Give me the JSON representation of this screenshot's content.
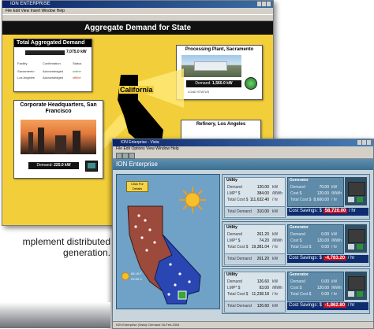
{
  "back_window": {
    "title": "ION ENTERPRISE",
    "menu": "File  Edit  View  Insert  Window  Help",
    "banner": "Aggregate Demand for State",
    "total_aggregated": {
      "title": "Total Aggregated Demand",
      "value": "7,075.0 kW",
      "columns": [
        "Facility",
        "Confirmation",
        "Status"
      ],
      "rows": [
        {
          "facility": "Sacramento",
          "confirmation": "Acknowledged",
          "status": "online"
        },
        {
          "facility": "Los Angeles",
          "confirmation": "Acknowledged",
          "status": "offline"
        }
      ]
    },
    "processing_plant": {
      "title": "Processing Plant, Sacramento",
      "demand_label": "Demand:",
      "demand_value": "1,560.0 kW",
      "status_label": "LOAD STATUS"
    },
    "state_label": "California",
    "hq": {
      "title": "Corporate Headquarters, San Francisco",
      "demand_label": "Demand:",
      "demand_value": "225.0 kW"
    },
    "refinery": {
      "title": "Refinery, Los Angeles"
    }
  },
  "front_window": {
    "title": "ION Enterprise - Vista",
    "menu": "File  Edit  Options  View  Window  Help",
    "header": "ION Enterprise",
    "map_button": "Click For Details",
    "temp_main": "85.15 F",
    "temp_sub": "29.59 C",
    "statusbar": "ION Enterprise (Vista): Demand 16-Feb-2004",
    "colors": {
      "savings_bg": "#0d2d6e",
      "savings_value_bg": "#d10f1f"
    },
    "rows": [
      {
        "utility": {
          "title": "Utility",
          "demand_label": "Demand",
          "demand": "120.00",
          "demand_unit": "kW",
          "lmp_label": "LMP* $",
          "lmp": "384.00",
          "lmp_unit": "/MWh",
          "total_cost_label": "Total Cost $",
          "total_cost": "111,632.40",
          "total_cost_unit": "/ hr",
          "total_demand_label": "Total Demand",
          "total_demand": "310.00",
          "total_demand_unit": "kW"
        },
        "generator": {
          "title": "Generator",
          "demand_label": "Demand",
          "demand": "70.00",
          "demand_unit": "kW",
          "cost_label": "Cost $",
          "cost": "120.00",
          "cost_unit": "/MWh",
          "total_cost_label": "Total Cost $",
          "total_cost": "8,600.00",
          "total_cost_unit": "/ hr"
        },
        "savings_label": "Cost Savings: $",
        "savings_value": "58,720.00",
        "savings_unit": "/ hr"
      },
      {
        "utility": {
          "title": "Utility",
          "demand_label": "Demand",
          "demand": "261.20",
          "demand_unit": "kW",
          "lmp_label": "LMP* $",
          "lmp": "74.20",
          "lmp_unit": "/MWh",
          "total_cost_label": "Total Cost $",
          "total_cost": "19,381.04",
          "total_cost_unit": "/ hr",
          "total_demand_label": "Total Demand",
          "total_demand": "261.20",
          "total_demand_unit": "kW"
        },
        "generator": {
          "title": "Generator",
          "demand_label": "Demand",
          "demand": "0.00",
          "demand_unit": "kW",
          "cost_label": "Cost $",
          "cost": "120.00",
          "cost_unit": "/MWh",
          "total_cost_label": "Total Cost $",
          "total_cost": "0.00",
          "total_cost_unit": "/ hr"
        },
        "savings_label": "Cost Savings: $",
        "savings_value": "-4,783.20",
        "savings_unit": "/ hr"
      },
      {
        "utility": {
          "title": "Utility",
          "demand_label": "Demand",
          "demand": "126.60",
          "demand_unit": "kW",
          "lmp_label": "LMP* $",
          "lmp": "93.00",
          "lmp_unit": "/MWh",
          "total_cost_label": "Total Cost $",
          "total_cost": "11,238.18",
          "total_cost_unit": "/ hr",
          "total_demand_label": "Total Demand",
          "total_demand": "126.60",
          "total_demand_unit": "kW"
        },
        "generator": {
          "title": "Generator",
          "demand_label": "Demand",
          "demand": "0.00",
          "demand_unit": "kW",
          "cost_label": "Cost $",
          "cost": "120.00",
          "cost_unit": "/MWh",
          "total_cost_label": "Total Cost $",
          "total_cost": "0.00",
          "total_cost_unit": "/ hr"
        },
        "savings_label": "Cost Savings: $",
        "savings_value": "-1,862.80",
        "savings_unit": "/ hr"
      }
    ]
  },
  "caption": {
    "line1": "mplement distributed",
    "line2": "generation."
  }
}
